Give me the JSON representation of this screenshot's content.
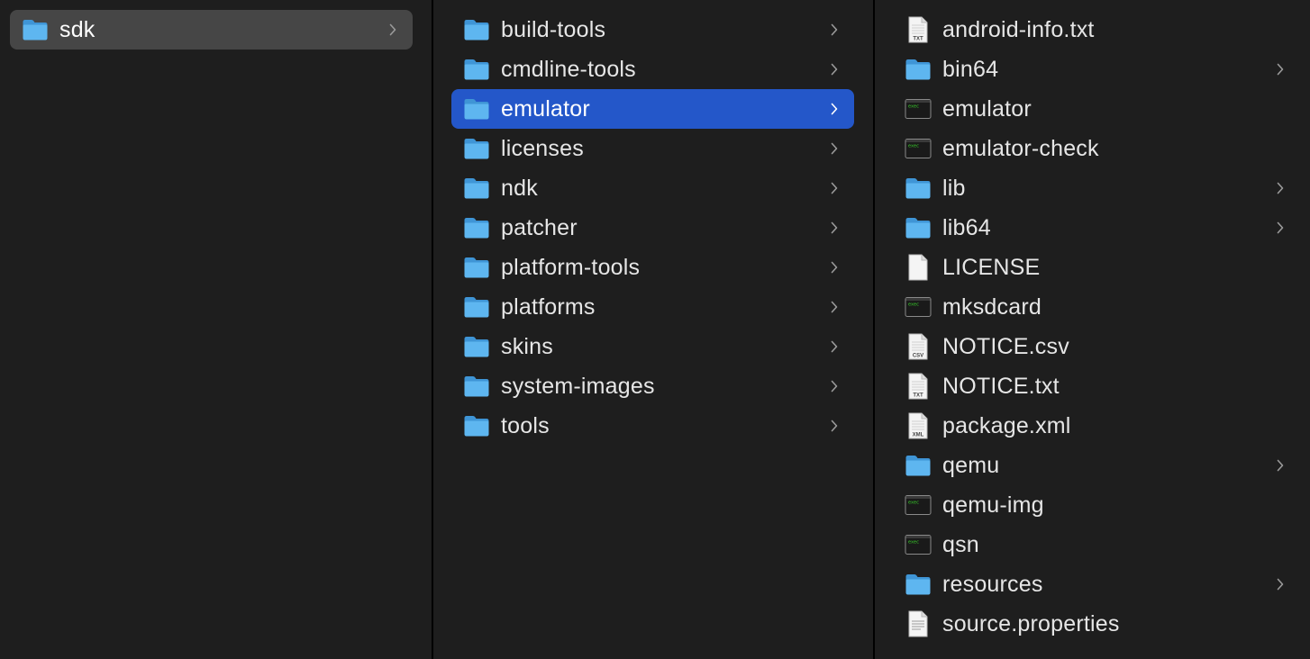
{
  "columns": [
    {
      "name": "column-1",
      "items": [
        {
          "label": "sdk",
          "kind": "folder",
          "state": "selected-inactive",
          "chevron": true
        }
      ]
    },
    {
      "name": "column-2",
      "items": [
        {
          "label": "build-tools",
          "kind": "folder",
          "chevron": true
        },
        {
          "label": "cmdline-tools",
          "kind": "folder",
          "chevron": true
        },
        {
          "label": "emulator",
          "kind": "folder",
          "state": "selected-active",
          "chevron": true
        },
        {
          "label": "licenses",
          "kind": "folder",
          "chevron": true
        },
        {
          "label": "ndk",
          "kind": "folder",
          "chevron": true
        },
        {
          "label": "patcher",
          "kind": "folder",
          "chevron": true
        },
        {
          "label": "platform-tools",
          "kind": "folder",
          "chevron": true
        },
        {
          "label": "platforms",
          "kind": "folder",
          "chevron": true
        },
        {
          "label": "skins",
          "kind": "folder",
          "chevron": true
        },
        {
          "label": "system-images",
          "kind": "folder",
          "chevron": true
        },
        {
          "label": "tools",
          "kind": "folder",
          "chevron": true
        }
      ]
    },
    {
      "name": "column-3",
      "items": [
        {
          "label": "android-info.txt",
          "kind": "doc",
          "badge": "TXT",
          "chevron": false
        },
        {
          "label": "bin64",
          "kind": "folder",
          "chevron": true
        },
        {
          "label": "emulator",
          "kind": "exec",
          "chevron": false
        },
        {
          "label": "emulator-check",
          "kind": "exec",
          "chevron": false
        },
        {
          "label": "lib",
          "kind": "folder",
          "chevron": true
        },
        {
          "label": "lib64",
          "kind": "folder",
          "chevron": true
        },
        {
          "label": "LICENSE",
          "kind": "blank",
          "chevron": false
        },
        {
          "label": "mksdcard",
          "kind": "exec",
          "chevron": false
        },
        {
          "label": "NOTICE.csv",
          "kind": "doc",
          "badge": "CSV",
          "chevron": false
        },
        {
          "label": "NOTICE.txt",
          "kind": "doc",
          "badge": "TXT",
          "chevron": false
        },
        {
          "label": "package.xml",
          "kind": "doc",
          "badge": "XML",
          "chevron": false
        },
        {
          "label": "qemu",
          "kind": "folder",
          "chevron": true
        },
        {
          "label": "qemu-img",
          "kind": "exec",
          "chevron": false
        },
        {
          "label": "qsn",
          "kind": "exec",
          "chevron": false
        },
        {
          "label": "resources",
          "kind": "folder",
          "chevron": true
        },
        {
          "label": "source.properties",
          "kind": "lines",
          "chevron": false
        }
      ]
    }
  ],
  "colors": {
    "background": "#1e1e1e",
    "selected_active": "#2457c9",
    "selected_inactive": "#464646",
    "folder": "#5eb6f0",
    "text": "#e6e6e6"
  }
}
